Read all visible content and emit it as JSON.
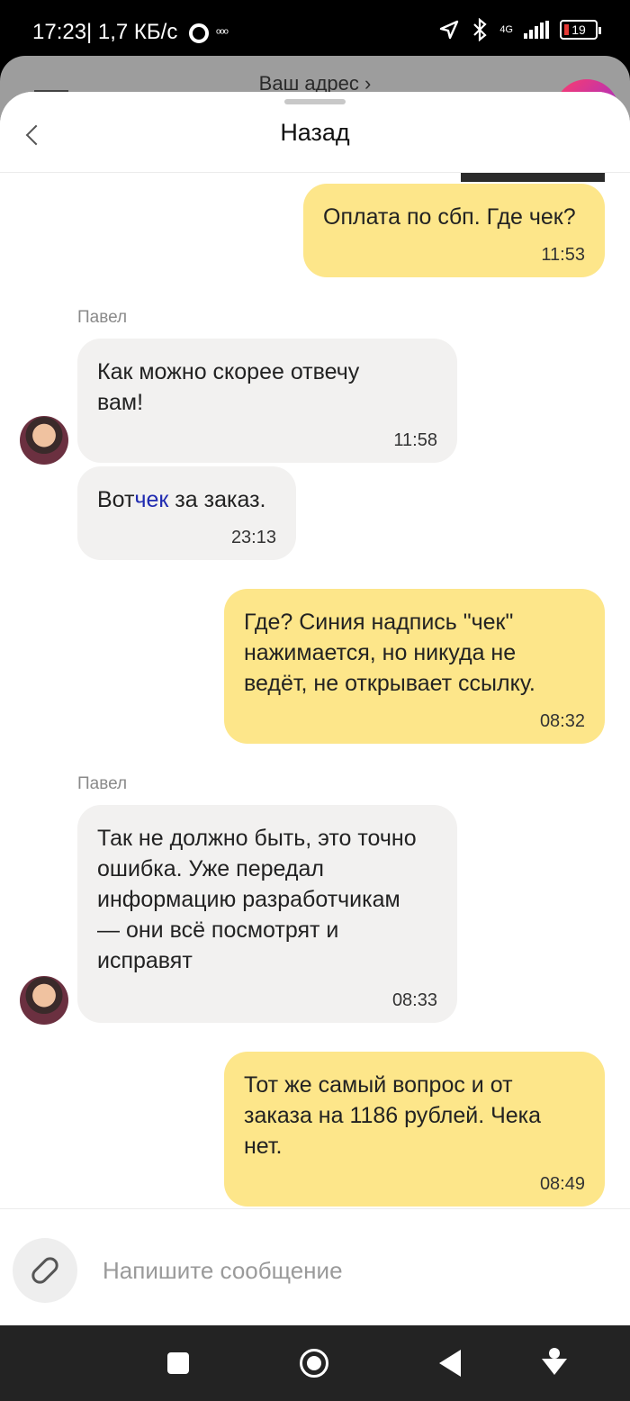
{
  "status_bar": {
    "time": "17:23",
    "speed": "| 1,7 КБ/с",
    "small_icons": "ᵒᵒᵒ",
    "network": "4G",
    "battery": "19"
  },
  "underlay": {
    "address_label": "Ваш адрес ›"
  },
  "header": {
    "title": "Назад"
  },
  "messages": [
    {
      "text": "Оплата по сбп. Где чек?",
      "time": "11:53"
    },
    {
      "sender": "Павел",
      "text": "Как можно скорее отвечу вам!",
      "time": "11:58"
    },
    {
      "text_before": "Вот",
      "link": "чек",
      "text_after": " за заказ.",
      "time": "23:13"
    },
    {
      "text": "Где? Синия надпись \"чек\" нажимается, но никуда не ведёт, не открывает ссылку.",
      "time": "08:32"
    },
    {
      "sender": "Павел",
      "text": "Так не должно быть, это точно ошибка. Уже передал информацию разработчикам — они всё посмотрят и исправят",
      "time": "08:33"
    },
    {
      "text": "Тот же самый вопрос и от заказа на 1186 рублей. Чека нет.",
      "time": "08:49"
    }
  ],
  "composer": {
    "placeholder": "Напишите сообщение"
  },
  "colors": {
    "outgoing": "#fde68a",
    "incoming": "#f2f1f0",
    "link": "#1f2ab0"
  },
  "icons": [
    "back-chevron-icon",
    "paperclip-icon",
    "square-icon",
    "home-circle-icon",
    "back-triangle-icon",
    "accessibility-icon"
  ]
}
